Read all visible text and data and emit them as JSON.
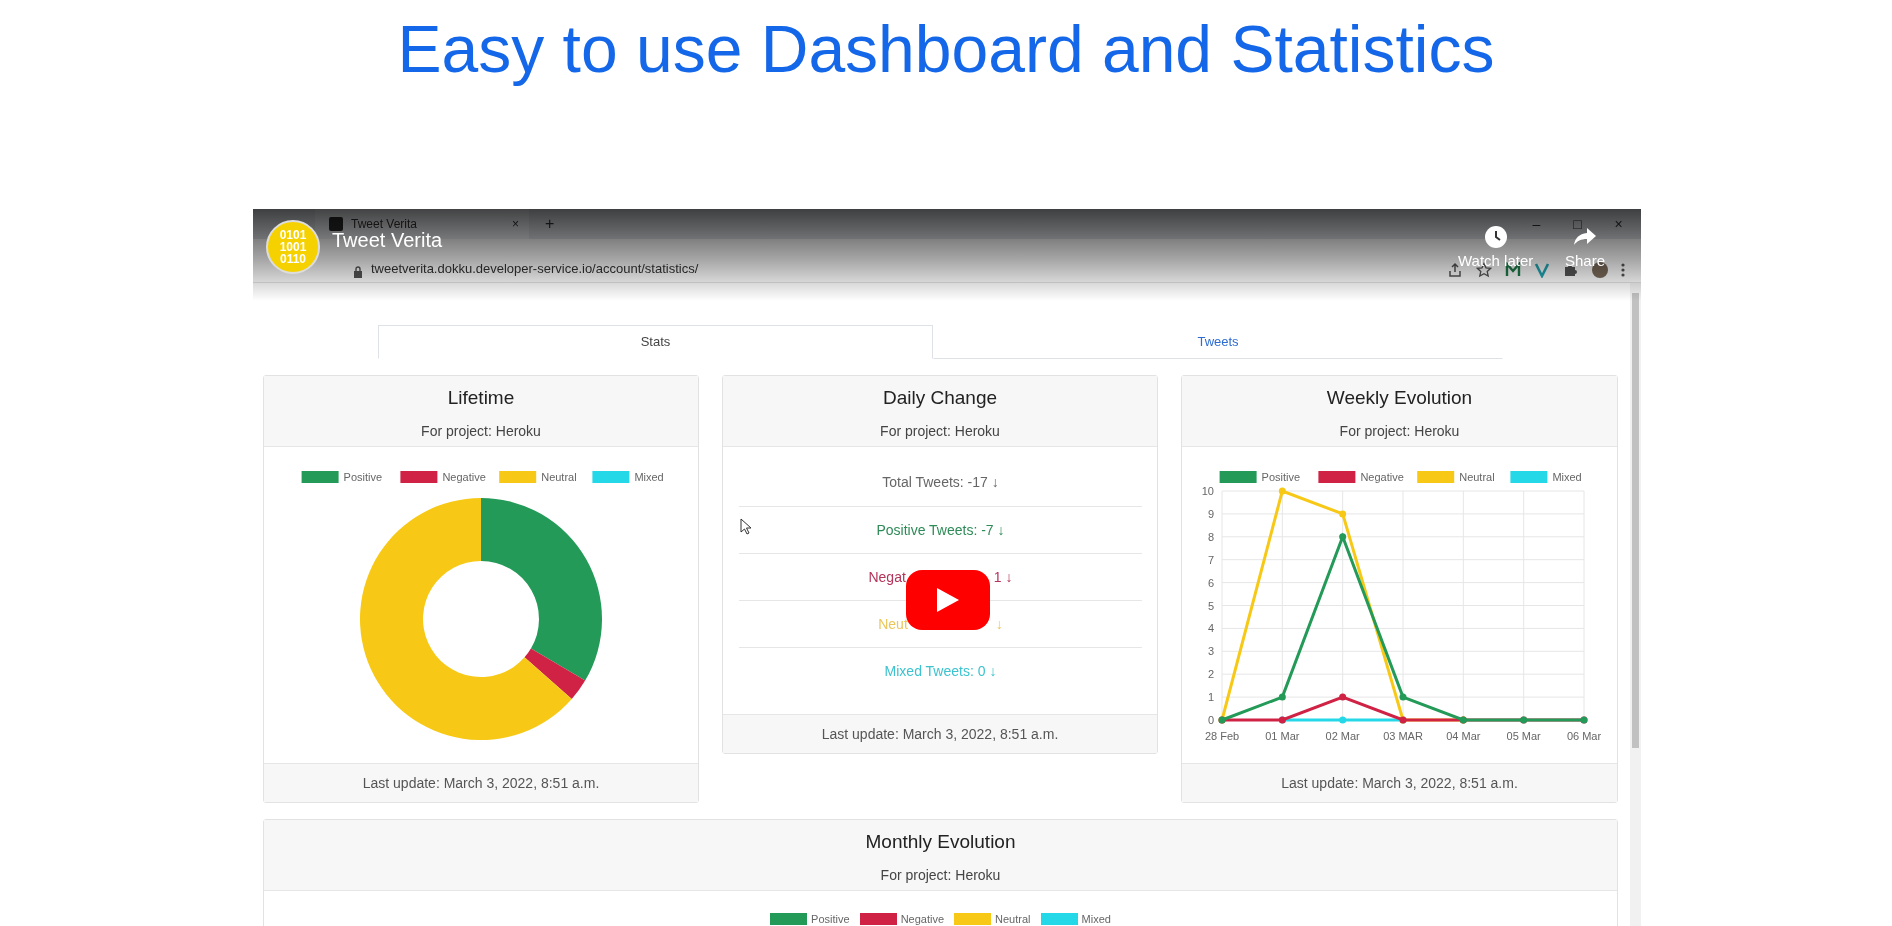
{
  "heading": "Easy to use Dashboard and Statistics",
  "video": {
    "title": "Tweet Verita",
    "logo_lines": [
      "0101",
      "1001",
      "0110"
    ],
    "actions": [
      {
        "label": "Watch later",
        "kind": "clock"
      },
      {
        "label": "Share",
        "kind": "share"
      }
    ]
  },
  "browser": {
    "tab_title": "Tweet Verita",
    "tab_close": "×",
    "new_tab": "+",
    "url": "tweetverita.dokku.developer-service.io/account/statistics/",
    "window_controls": [
      "–",
      "□",
      "×"
    ]
  },
  "tabs": [
    {
      "label": "Stats",
      "selected": true
    },
    {
      "label": "Tweets",
      "selected": false
    }
  ],
  "lifetime": {
    "title": "Lifetime",
    "subtitle": "For project: Heroku",
    "legend": [
      {
        "label": "Positive",
        "color": "#239a57"
      },
      {
        "label": "Negative",
        "color": "#cf2245"
      },
      {
        "label": "Neutral",
        "color": "#f7c916"
      },
      {
        "label": "Mixed",
        "color": "#25d8e8"
      }
    ],
    "footer": "Last update: March 3, 2022, 8:51 a.m."
  },
  "daily_change": {
    "title": "Daily Change",
    "subtitle": "For project: Heroku",
    "rows": [
      {
        "parts": [
          "Total Tweets: -17 ↓"
        ],
        "color": "#666666"
      },
      {
        "parts": [
          "Positive Tweets: -7 ↓"
        ],
        "color": "#2e8b57"
      },
      {
        "parts": [
          "Negat",
          "1 ↓"
        ],
        "color": "#b4345a"
      },
      {
        "parts": [
          "Neut",
          "↓"
        ],
        "color": "#ecc65a"
      },
      {
        "parts": [
          "Mixed Tweets: 0 ↓"
        ],
        "color": "#3cc3cf"
      }
    ],
    "footer": "Last update: March 3, 2022, 8:51 a.m."
  },
  "weekly_evolution": {
    "title": "Weekly Evolution",
    "subtitle": "For project: Heroku",
    "chart_data": {
      "type": "line",
      "categories": [
        "28 Feb",
        "01 Mar",
        "02 Mar",
        "03 MAR",
        "04 Mar",
        "05 Mar",
        "06 Mar"
      ],
      "series": [
        {
          "name": "Positive",
          "color": "#239a57",
          "values": [
            0,
            1,
            8,
            1,
            0,
            0,
            0
          ],
          "marker": "circle"
        },
        {
          "name": "Negative",
          "color": "#cf2245",
          "values": [
            0,
            0,
            1,
            0,
            0,
            0,
            0
          ],
          "marker": "circle"
        },
        {
          "name": "Neutral",
          "color": "#f7c916",
          "values": [
            0,
            10,
            9,
            0,
            0,
            null,
            null
          ],
          "marker": "circle"
        },
        {
          "name": "Mixed",
          "color": "#25d8e8",
          "values": [
            null,
            0,
            0,
            0,
            null,
            null,
            null
          ],
          "marker": "circle"
        }
      ],
      "grid": true,
      "legend": "top",
      "ylim": [
        0,
        10
      ],
      "yticks": [
        0,
        1,
        2,
        3,
        4,
        5,
        6,
        7,
        8,
        9,
        10
      ]
    },
    "footer": "Last update: March 3, 2022, 8:51 a.m."
  },
  "monthly_evolution": {
    "title": "Monthly Evolution",
    "subtitle": "For project: Heroku",
    "legend": [
      {
        "label": "Positive",
        "color": "#239a57"
      },
      {
        "label": "Negative",
        "color": "#cf2245"
      },
      {
        "label": "Neutral",
        "color": "#f7c916"
      },
      {
        "label": "Mixed",
        "color": "#25d8e8"
      }
    ]
  }
}
